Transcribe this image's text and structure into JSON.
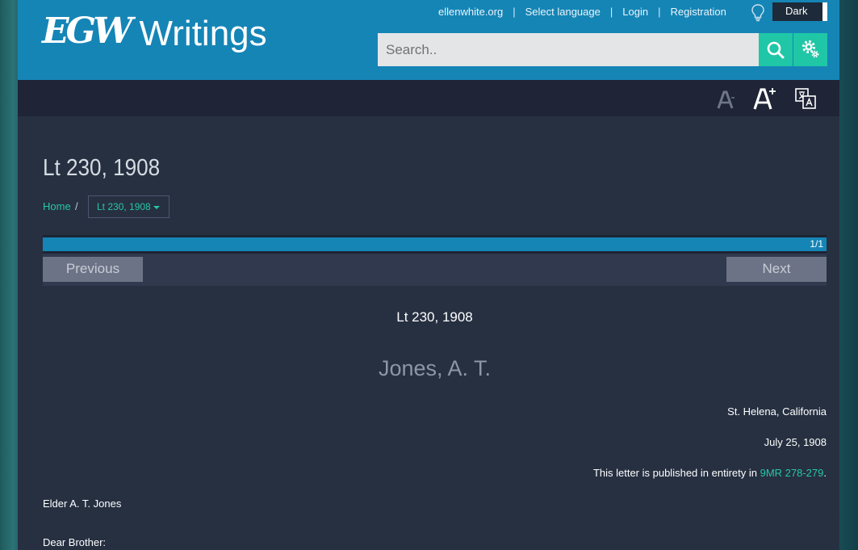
{
  "header": {
    "logo_mark": "EGW",
    "logo_text": "Writings",
    "links": [
      "ellenwhite.org",
      "Select language",
      "Login",
      "Registration"
    ],
    "theme_toggle": "Dark",
    "search_placeholder": "Search..",
    "search_icon": "search-icon",
    "settings_icon": "gear-icon"
  },
  "toolbar": {
    "font_decrease_icon": "font-decrease-icon",
    "font_increase_icon": "font-increase-icon",
    "translate_icon": "translate-icon"
  },
  "document": {
    "title": "Lt 230, 1908",
    "breadcrumb": {
      "home": "Home",
      "separator": "/",
      "current": "Lt 230, 1908"
    },
    "pagination": {
      "label": "1/1",
      "progress": 1.0,
      "previous": "Previous",
      "next": "Next"
    },
    "letter_id": "Lt 230, 1908",
    "recipient": "Jones, A. T.",
    "place": "St. Helena, California",
    "date": "July 25, 1908",
    "pub_note_prefix": "This letter is published in entirety in ",
    "pub_note_link": "9MR 278-279",
    "pub_note_suffix": ".",
    "addressee": "Elder A. T. Jones",
    "salutation": "Dear Brother:"
  },
  "colors": {
    "header_blue": "#1585b6",
    "accent_teal": "#1fc7a6",
    "link_teal": "#27c6a5",
    "content_bg": "#263041"
  }
}
